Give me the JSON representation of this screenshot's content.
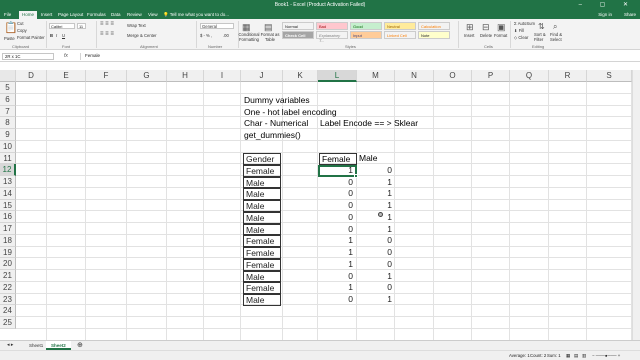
{
  "window": {
    "title": "Book1 - Excel (Product Activation Failed)",
    "controls": "–  ▢  ✕"
  },
  "ribbon_tabs": [
    {
      "label": "File",
      "active": false
    },
    {
      "label": "Home",
      "active": true
    },
    {
      "label": "Insert",
      "active": false
    },
    {
      "label": "Page Layout",
      "active": false
    },
    {
      "label": "Formulas",
      "active": false
    },
    {
      "label": "Data",
      "active": false
    },
    {
      "label": "Review",
      "active": false
    },
    {
      "label": "View",
      "active": false
    }
  ],
  "tell_me": "Tell me what you want to do...",
  "sign_in": "Sign in",
  "share": "Share",
  "clipboard": {
    "cut": "Cut",
    "copy": "Copy",
    "format_painter": "Format Painter",
    "label": "Clipboard",
    "paste": "Paste"
  },
  "font": {
    "name": "Calibri",
    "size": "11",
    "label": "Font",
    "bold": "B",
    "italic": "I",
    "underline": "U"
  },
  "alignment": {
    "wrap": "Wrap Text",
    "merge": "Merge & Center",
    "label": "Alignment"
  },
  "number": {
    "format": "General",
    "label": "Number",
    "currency": "$ - % ,",
    "decimals": ".00"
  },
  "styles": {
    "conditional": "Conditional Formatting",
    "format_as_table": "Format as Table",
    "label": "Styles",
    "cells": [
      {
        "label": "Normal",
        "bg": "#ffffff",
        "fg": "#000000"
      },
      {
        "label": "Bad",
        "bg": "#ffc7ce",
        "fg": "#9c0006"
      },
      {
        "label": "Good",
        "bg": "#c6efce",
        "fg": "#006100"
      },
      {
        "label": "Neutral",
        "bg": "#ffeb9c",
        "fg": "#9c6500"
      },
      {
        "label": "Calculation",
        "bg": "#f2f2f2",
        "fg": "#fa7d00"
      },
      {
        "label": "Check Cell",
        "bg": "#a5a5a5",
        "fg": "#ffffff"
      },
      {
        "label": "Explanatory T...",
        "bg": "#ffffff",
        "fg": "#7f7f7f"
      },
      {
        "label": "Input",
        "bg": "#ffcc99",
        "fg": "#3f3f76"
      },
      {
        "label": "Linked Cell",
        "bg": "#ffffff",
        "fg": "#fa7d00"
      },
      {
        "label": "Note",
        "bg": "#ffffcc",
        "fg": "#000000"
      }
    ]
  },
  "cells_group": {
    "insert": "Insert",
    "delete": "Delete",
    "format": "Format",
    "label": "Cells"
  },
  "editing": {
    "autosum": "AutoSum",
    "fill": "Fill",
    "clear": "Clear",
    "sort": "Sort & Filter",
    "find": "Find & Select",
    "label": "Editing"
  },
  "formula_bar": {
    "name_box": "2R x 1C",
    "fx": "fx",
    "content": "Female"
  },
  "columns": [
    "D",
    "E",
    "F",
    "G",
    "H",
    "I",
    "J",
    "K",
    "L",
    "M",
    "N",
    "O",
    "P",
    "Q",
    "R",
    "S"
  ],
  "selected_column": "L",
  "rows": [
    "5",
    "6",
    "7",
    "8",
    "9",
    "10",
    "11",
    "12",
    "13",
    "14",
    "15",
    "16",
    "17",
    "18",
    "19",
    "20",
    "21",
    "22",
    "23",
    "24",
    "25"
  ],
  "selected_row": "12",
  "notes": [
    "Dummy variables",
    "One - hot label encoding",
    "Char - Numerical",
    "get_dummies()"
  ],
  "label_encode_note": "Label Encode == > Sklear",
  "headers": {
    "gender": "Gender",
    "female": "Female",
    "male": "Male"
  },
  "table": [
    {
      "gender": "Female",
      "female": "1",
      "male": "0"
    },
    {
      "gender": "Male",
      "female": "0",
      "male": "1"
    },
    {
      "gender": "Male",
      "female": "0",
      "male": "1"
    },
    {
      "gender": "Male",
      "female": "0",
      "male": "1"
    },
    {
      "gender": "Male",
      "female": "0",
      "male": "1"
    },
    {
      "gender": "Male",
      "female": "0",
      "male": "1"
    },
    {
      "gender": "Female",
      "female": "1",
      "male": "0"
    },
    {
      "gender": "Female",
      "female": "1",
      "male": "0"
    },
    {
      "gender": "Female",
      "female": "1",
      "male": "0"
    },
    {
      "gender": "Male",
      "female": "0",
      "male": "1"
    },
    {
      "gender": "Female",
      "female": "1",
      "male": "0"
    },
    {
      "gender": "Male",
      "female": "0",
      "male": "1"
    }
  ],
  "sheets": [
    {
      "label": "Sheet1",
      "active": false
    },
    {
      "label": "Sheet2",
      "active": true
    }
  ],
  "status": {
    "average": "Average: 1",
    "count": "Count: 2",
    "sum": "Sum: 1"
  },
  "colors": {
    "excel_green": "#217346"
  }
}
